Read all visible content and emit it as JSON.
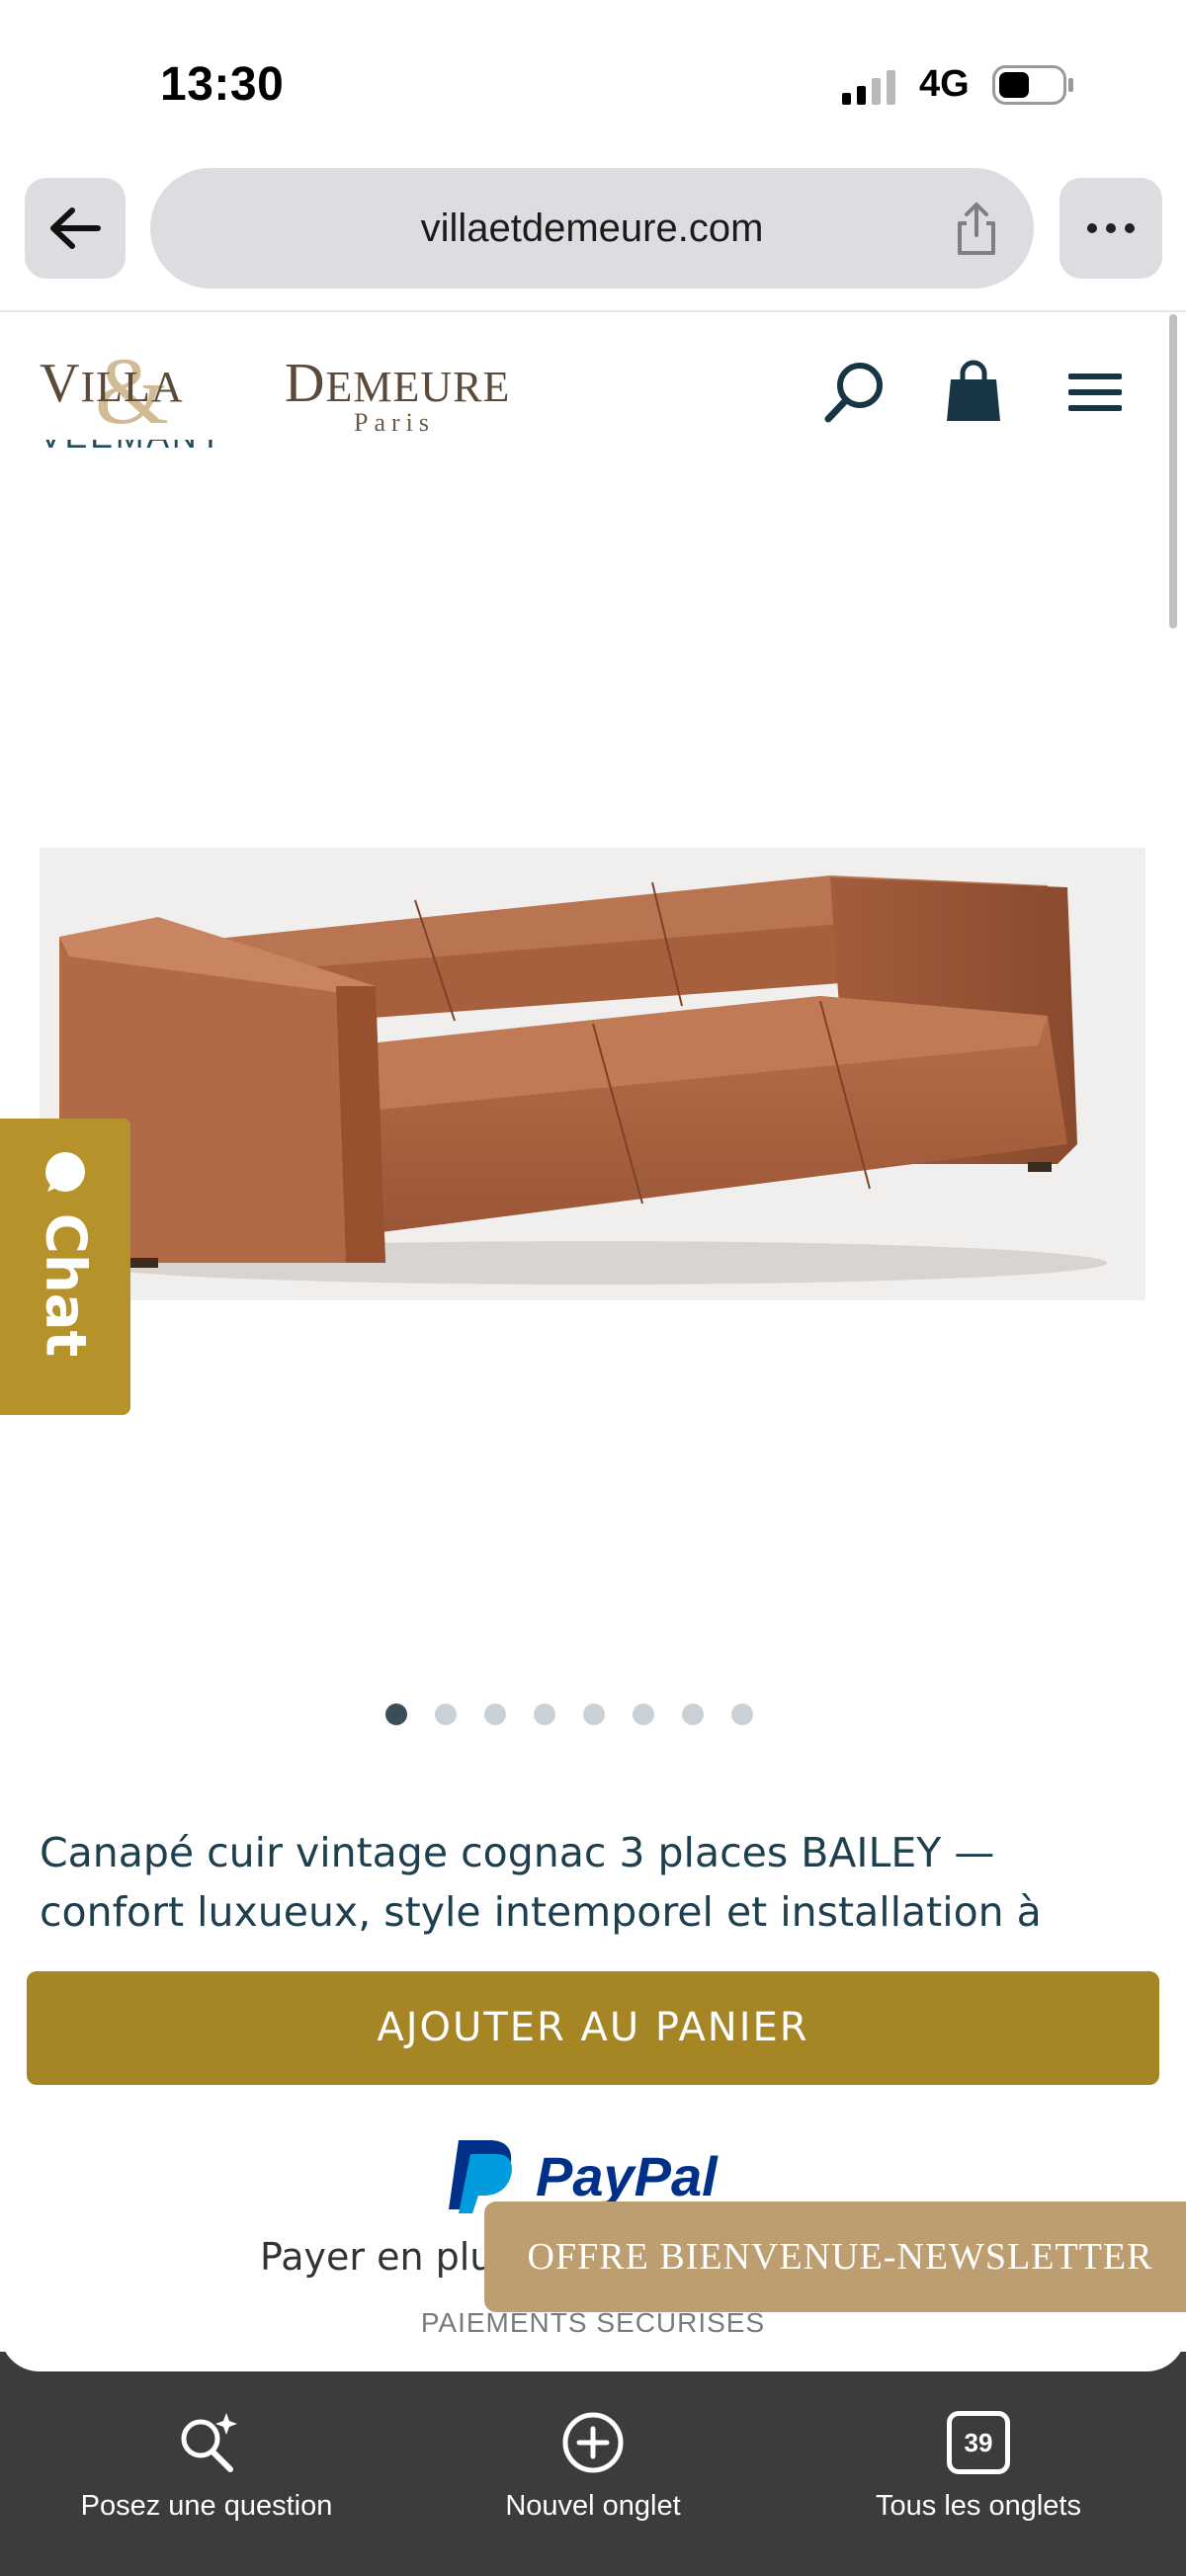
{
  "status_bar": {
    "time": "13:30",
    "network": "4G"
  },
  "browser": {
    "url": "villaetdemeure.com",
    "toolbar": {
      "ask": "Posez une question",
      "new_tab": "Nouvel onglet",
      "all_tabs": "Tous les onglets",
      "tab_count": "39"
    }
  },
  "site": {
    "logo_text": "VILLA & DEMEURE Paris",
    "cut_heading": "VEEMANY",
    "chat_label": "Chat",
    "carousel": {
      "count": 8,
      "active": 0
    },
    "description": "Canapé cuir vintage cognac 3 places BAILEY — confort luxueux, style intemporel et installation à",
    "add_to_cart": "AJOUTER AU PANIER",
    "paypal_brand": "PayPal",
    "pay_later": "Payer en plu",
    "secure": "PAIEMENTS SÉCURISÉS",
    "newsletter": "OFFRE BIENVENUE-NEWSLETTER"
  },
  "colors": {
    "gold": "#a68524",
    "chat": "#b6922a",
    "newsletter": "#bc9e70",
    "teal": "#1e3f4d",
    "toolbar": "#3c3c3c"
  }
}
